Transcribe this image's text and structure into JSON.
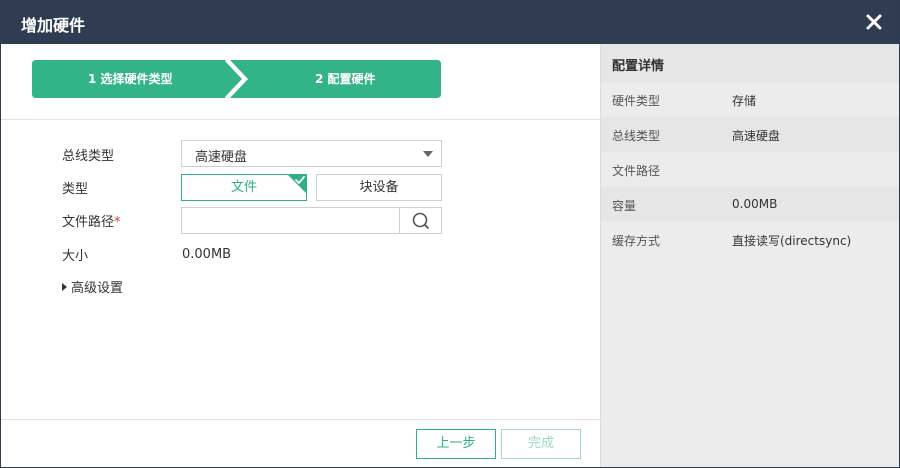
{
  "dialog": {
    "title": "增加硬件"
  },
  "steps": [
    {
      "label": "1 选择硬件类型"
    },
    {
      "label": "2 配置硬件"
    }
  ],
  "form": {
    "bus_type": {
      "label": "总线类型",
      "value": "高速硬盘"
    },
    "type": {
      "label": "类型",
      "options": [
        "文件",
        "块设备"
      ],
      "selected": "文件"
    },
    "file_path": {
      "label": "文件路径",
      "required_mark": "*",
      "value": ""
    },
    "size": {
      "label": "大小",
      "value": "0.00MB"
    },
    "advanced": {
      "label": "高级设置"
    }
  },
  "buttons": {
    "prev": "上一步",
    "done": "完成"
  },
  "details": {
    "title": "配置详情",
    "rows": [
      {
        "key": "硬件类型",
        "value": "存储"
      },
      {
        "key": "总线类型",
        "value": "高速硬盘"
      },
      {
        "key": "文件路径",
        "value": ""
      },
      {
        "key": "容量",
        "value": "0.00MB"
      },
      {
        "key": "缓存方式",
        "value": "直接读写(directsync)"
      }
    ]
  },
  "colors": {
    "accent": "#2eb086",
    "titlebar": "#2f3c52",
    "panel": "#ececec"
  }
}
